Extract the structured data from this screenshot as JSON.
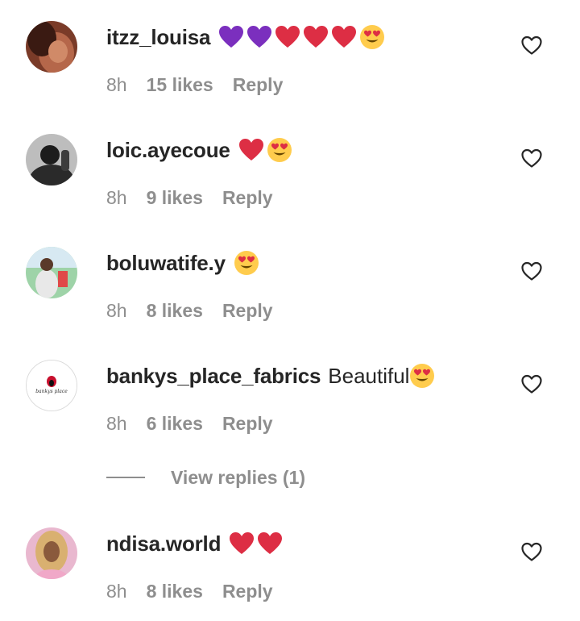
{
  "comments": [
    {
      "username": "itzz_louisa",
      "text": "",
      "emojis": [
        "purple-heart",
        "purple-heart",
        "red-heart",
        "red-heart",
        "red-heart",
        "heart-eyes"
      ],
      "time": "8h",
      "likes": "15 likes",
      "reply": "Reply"
    },
    {
      "username": "loic.ayecoue",
      "text": "",
      "emojis": [
        "red-heart",
        "heart-eyes"
      ],
      "time": "8h",
      "likes": "9 likes",
      "reply": "Reply"
    },
    {
      "username": "boluwatife.y",
      "text": "",
      "emojis": [
        "heart-eyes"
      ],
      "time": "8h",
      "likes": "8 likes",
      "reply": "Reply"
    },
    {
      "username": "bankys_place_fabrics",
      "text": "Beautiful",
      "emojis": [
        "heart-eyes"
      ],
      "time": "8h",
      "likes": "6 likes",
      "reply": "Reply",
      "avatar_logo_text": "bankys place"
    },
    {
      "username": "ndisa.world",
      "text": "",
      "emojis": [
        "red-heart",
        "red-heart"
      ],
      "time": "8h",
      "likes": "8 likes",
      "reply": "Reply"
    }
  ],
  "view_replies": {
    "label": "View replies (1)"
  },
  "colors": {
    "primary_text": "#262626",
    "secondary_text": "#8e8e8e",
    "red_heart": "#dd2e44",
    "purple_heart": "#7b2fbe",
    "emoji_face": "#ffcc4d"
  },
  "icons": {
    "like": "heart-outline-icon"
  }
}
